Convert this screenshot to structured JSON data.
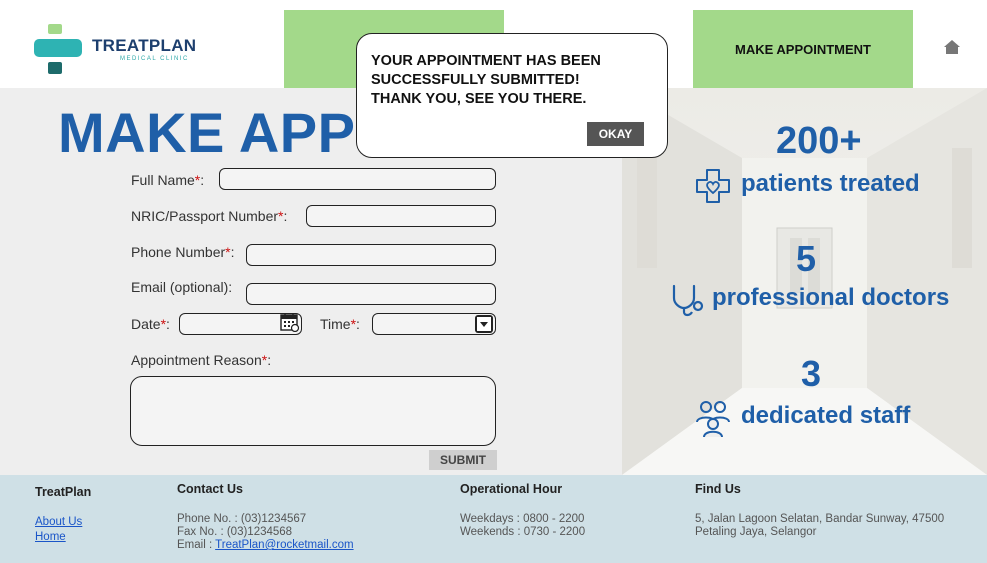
{
  "header": {
    "logo_title": "TREATPLAN",
    "logo_subtitle": "MEDICAL CLINIC",
    "nav_make_appointment": "MAKE APPOINTMENT",
    "home_icon": "home-icon"
  },
  "page": {
    "title": "MAKE APPOINTMENT"
  },
  "form": {
    "full_name_label": "Full Name",
    "nric_label": "NRIC/Passport Number",
    "phone_label": "Phone Number",
    "email_label": "Email (optional):",
    "date_label": "Date",
    "time_label": "Time",
    "reason_label": "Appointment Reason",
    "required_mark": "*",
    "colon": ":",
    "submit_label": "SUBMIT",
    "full_name_value": "",
    "nric_value": "",
    "phone_value": "",
    "email_value": "",
    "date_value": "",
    "time_value": "",
    "reason_value": ""
  },
  "stats": [
    {
      "number": "200+",
      "label": "patients treated",
      "icon": "medical-cross-heart-icon"
    },
    {
      "number": "5",
      "label": "professional doctors",
      "icon": "stethoscope-icon"
    },
    {
      "number": "3",
      "label": "dedicated staff",
      "icon": "staff-group-icon"
    }
  ],
  "modal": {
    "message": "YOUR APPOINTMENT HAS BEEN\nSUCCESSFULLY SUBMITTED!\nTHANK YOU, SEE YOU THERE.",
    "okay_label": "OKAY"
  },
  "footer": {
    "brand": "TreatPlan",
    "about_link": "About Us",
    "home_link": "Home",
    "contact_head": "Contact Us",
    "phone": "Phone No. : (03)1234567",
    "fax": "Fax No. : (03)1234568",
    "email_prefix": "Email : ",
    "email": "TreatPlan@rocketmail.com",
    "hours_head": "Operational Hour",
    "weekdays": "Weekdays : 0800 - 2200",
    "weekends": "Weekends : 0730 - 2200",
    "find_head": "Find Us",
    "address_line1": "5, Jalan Lagoon Selatan, Bandar Sunway, 47500",
    "address_line2": "Petaling Jaya, Selangor"
  },
  "colors": {
    "accent_blue": "#1f5fa8",
    "nav_green": "#a3d98a",
    "footer_bg": "#cfe0e6",
    "required_red": "#cc1111"
  }
}
